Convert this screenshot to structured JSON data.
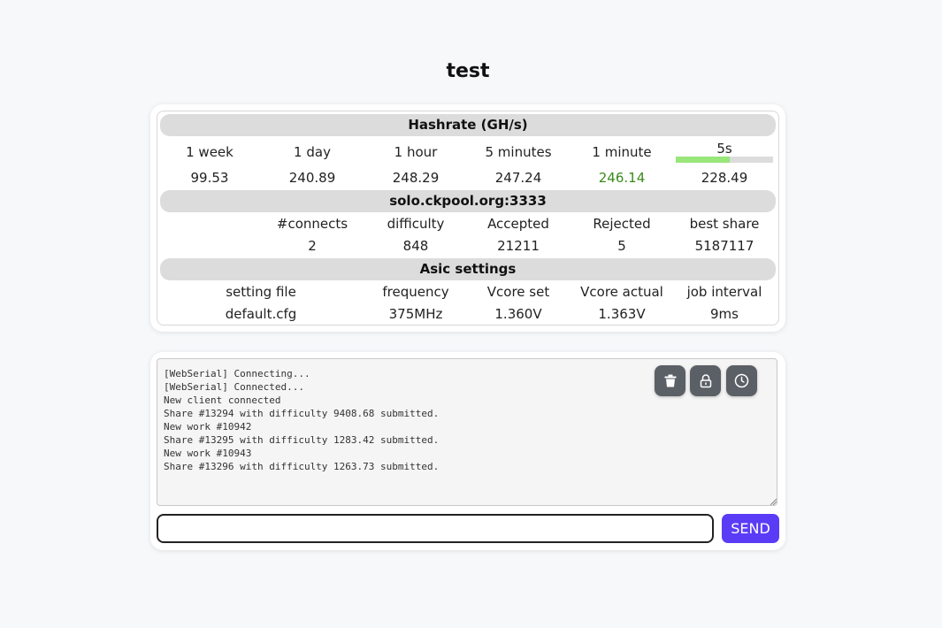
{
  "page": {
    "title": "test"
  },
  "hashrate": {
    "header": "Hashrate (GH/s)",
    "labels": [
      "1 week",
      "1 day",
      "1 hour",
      "5 minutes",
      "1 minute",
      "5s"
    ],
    "values": [
      "99.53",
      "240.89",
      "248.29",
      "247.24",
      "246.14",
      "228.49"
    ],
    "highlight_color": "#3a8a1a",
    "progress_5s_fraction": 0.55,
    "progress_color": "#99e67a"
  },
  "pool": {
    "header": "solo.ckpool.org:3333",
    "labels": [
      "#connects",
      "difficulty",
      "Accepted",
      "Rejected",
      "best share"
    ],
    "values": [
      "2",
      "848",
      "21211",
      "5",
      "5187117"
    ]
  },
  "asic": {
    "header": "Asic settings",
    "labels": [
      "setting file",
      "frequency",
      "Vcore set",
      "Vcore actual",
      "job interval"
    ],
    "values": [
      "default.cfg",
      "375MHz",
      "1.360V",
      "1.363V",
      "9ms"
    ]
  },
  "console": {
    "log_lines": [
      "[WebSerial] Connecting...",
      "[WebSerial] Connected...",
      "New client connected",
      "Share #13294 with difficulty 9408.68 submitted.",
      "New work #10942",
      "Share #13295 with difficulty 1283.42 submitted.",
      "New work #10943",
      "Share #13296 with difficulty 1263.73 submitted."
    ],
    "buttons": [
      {
        "name": "clear-log-button",
        "icon": "trash-icon"
      },
      {
        "name": "scroll-lock-button",
        "icon": "lock-open-icon"
      },
      {
        "name": "timestamp-button",
        "icon": "clock-icon"
      }
    ],
    "input_value": "",
    "send_label": "SEND",
    "send_color": "#5b3cf6"
  }
}
